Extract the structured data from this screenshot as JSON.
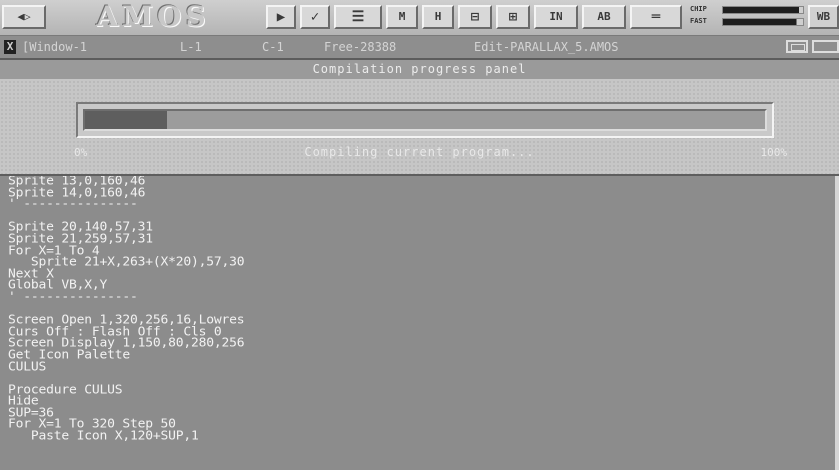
{
  "toolbar": {
    "nav_arrows": "◀▷",
    "logo_text": "AMOS",
    "buttons": [
      {
        "icon": "play-icon",
        "glyph": "▶"
      },
      {
        "icon": "check-icon",
        "glyph": "✓"
      },
      {
        "icon": "lines-icon",
        "glyph": "☰"
      },
      {
        "icon": "memory-icon",
        "glyph": "M"
      },
      {
        "icon": "help-icon",
        "glyph": "H"
      },
      {
        "icon": "fold-icon",
        "glyph": "⊟"
      },
      {
        "icon": "unfold-icon",
        "glyph": "⊞"
      },
      {
        "icon": "insert-icon",
        "glyph": "IN"
      },
      {
        "icon": "abc-icon",
        "glyph": "AB"
      },
      {
        "icon": "ruler-icon",
        "glyph": "═"
      }
    ],
    "chip_label": "CHIP",
    "fast_label": "FAST",
    "chip_level": 0.95,
    "fast_level": 0.92,
    "wb_label": "WB"
  },
  "titlebar": {
    "window": "[Window-1",
    "line": "L-1",
    "column": "C-1",
    "free": "Free-28388",
    "edit": "Edit-PARALLAX_5.AMOS"
  },
  "panel": {
    "title": "Compilation progress panel",
    "progress_percent": 12,
    "label_min": "0%",
    "label_max": "100%",
    "status": "Compiling current program..."
  },
  "editor": {
    "lines": [
      "Sprite 13,0,160,46",
      "Sprite 14,0,160,46",
      "' ---------------",
      "",
      "Sprite 20,140,57,31",
      "Sprite 21,259,57,31",
      "For X=1 To 4",
      "   Sprite 21+X,263+(X*20),57,30",
      "Next X",
      "Global VB,X,Y",
      "' ---------------",
      "",
      "Screen Open 1,320,256,16,Lowres",
      "Curs Off : Flash Off : Cls 0",
      "Screen Display 1,150,80,280,256",
      "Get Icon Palette",
      "CULUS",
      "",
      "Procedure CULUS",
      "Hide",
      "SUP=36",
      "For X=1 To 320 Step 50",
      "   Paste Icon X,120+SUP,1"
    ]
  }
}
